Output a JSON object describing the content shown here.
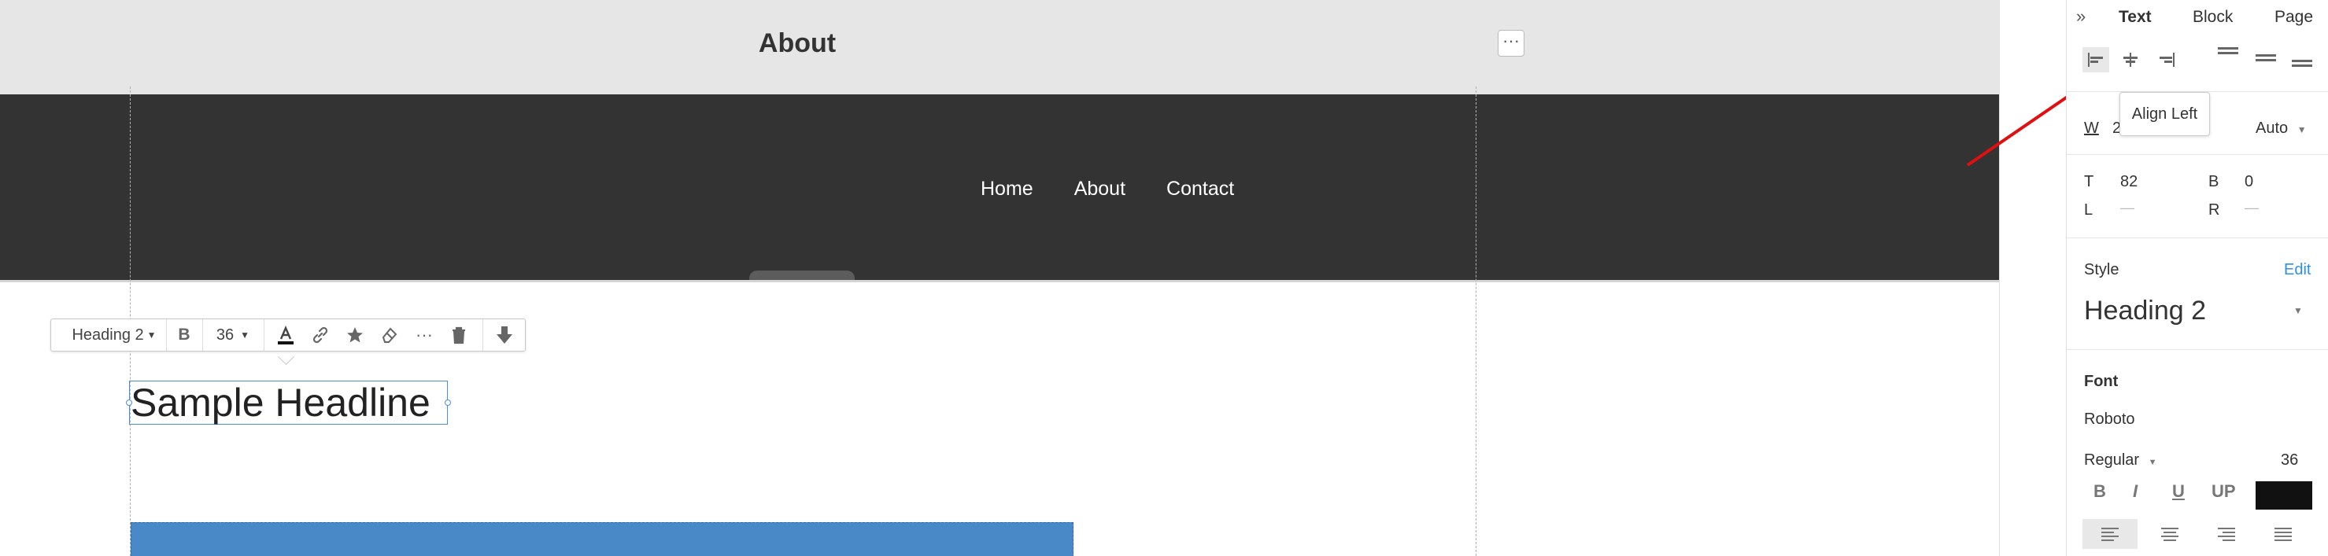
{
  "canvas": {
    "page_title": "About",
    "page_menu_icon": "ellipsis-icon",
    "nav": [
      "Home",
      "About",
      "Contact"
    ],
    "toolbar": {
      "style_label": "Heading 2",
      "bold_label": "B",
      "size_value": "36",
      "icons": [
        "text-color-icon",
        "link-icon",
        "star-icon",
        "eraser-icon",
        "more-icon",
        "trash-icon",
        "move-down-icon"
      ]
    },
    "headline_text": "Sample Headline",
    "accent_color": "#4a89c8"
  },
  "panel": {
    "tabs": [
      "Text",
      "Block",
      "Page"
    ],
    "active_tab": "Text",
    "tooltip": "Align Left",
    "width_label": "W",
    "width_value": "2",
    "width_unit": "Auto",
    "spacing": {
      "t_label": "T",
      "t_value": "82",
      "b_label": "B",
      "b_value": "0",
      "l_label": "L",
      "l_value": "—",
      "r_label": "R",
      "r_value": "—"
    },
    "style_label": "Style",
    "style_edit": "Edit",
    "style_value": "Heading 2",
    "font_label": "Font",
    "font_family": "Roboto",
    "font_weight": "Regular",
    "font_size": "36",
    "format_buttons": [
      "B",
      "I",
      "U",
      "UP"
    ],
    "text_color": "#111111",
    "link_color": "#2f8fe0"
  }
}
